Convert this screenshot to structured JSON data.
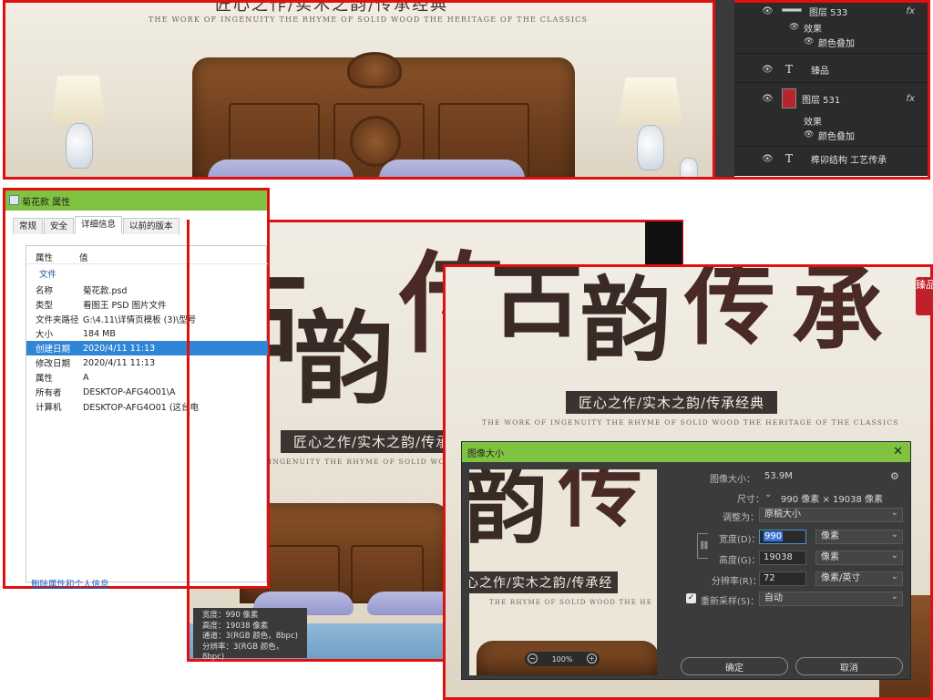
{
  "top_photo": {
    "title_line": "匠心之作/实木之韵/传承经典",
    "eng_line": "THE WORK OF INGENUITY   THE RHYME OF SOLID WOOD THE HERITAGE OF THE CLASSICS"
  },
  "layers_panel": {
    "rows": [
      {
        "label": "图层 533",
        "fx": "fx",
        "kind": "layer"
      },
      {
        "label": "效果",
        "kind": "effects"
      },
      {
        "label": "颜色叠加",
        "kind": "effect"
      },
      {
        "label": "臻品",
        "kind": "text",
        "icon": "T"
      },
      {
        "label": "图层 531",
        "fx": "fx",
        "kind": "layer"
      },
      {
        "label": "效果",
        "kind": "effects"
      },
      {
        "label": "颜色叠加",
        "kind": "effect"
      },
      {
        "label": "榫卯结构 工艺传承",
        "kind": "text",
        "icon": "T"
      }
    ]
  },
  "properties": {
    "title": "菊花款 属性",
    "tabs": [
      "常规",
      "安全",
      "详细信息",
      "以前的版本"
    ],
    "active_tab": "详细信息",
    "header_key": "属性",
    "header_val": "值",
    "section": "文件",
    "rows": [
      {
        "k": "名称",
        "v": "菊花款.psd"
      },
      {
        "k": "类型",
        "v": "看图王 PSD 图片文件"
      },
      {
        "k": "文件夹路径",
        "v": "G:\\4.11\\详情页模板 (3)\\型号"
      },
      {
        "k": "大小",
        "v": "184 MB"
      },
      {
        "k": "创建日期",
        "v": "2020/4/11 11:13"
      },
      {
        "k": "修改日期",
        "v": "2020/4/11 11:13"
      },
      {
        "k": "属性",
        "v": "A"
      },
      {
        "k": "所有者",
        "v": "DESKTOP-AFG4O01\\A"
      },
      {
        "k": "计算机",
        "v": "DESKTOP-AFG4O01 (这台电"
      }
    ],
    "remove_link": "删除属性和个人信息"
  },
  "mid_image": {
    "chars": [
      "古",
      "韵",
      "传"
    ],
    "sub": "匠心之作/实木之韵/传承",
    "eng": "THE WORK OF INGENUITY   THE RHYME OF SOLID WO",
    "info": [
      "宽度：990 像素",
      "高度：19038 像素",
      "通道：3(RGB 颜色，8bpc)",
      "分辨率：3(RGB 颜色，8bpc)"
    ]
  },
  "front_image": {
    "chars": [
      "古",
      "韵",
      "传",
      "承"
    ],
    "stamp": "臻品",
    "sub": "匠心之作/实木之韵/传承经典",
    "eng": "THE WORK OF INGENUITY   THE RHYME OF SOLID WOOD THE HERITAGE OF THE CLASSICS"
  },
  "image_size_dialog": {
    "title": "图像大小",
    "close": "✕",
    "image_size_label": "图像大小：",
    "image_size_value": "53.9M",
    "dimensions_label": "尺寸：",
    "dimensions_value": "990 像素 × 19038 像素",
    "fit_label": "调整为：",
    "fit_value": "原稿大小",
    "width_label": "宽度(D)：",
    "width_value": "990",
    "width_unit": "像素",
    "height_label": "高度(G)：",
    "height_value": "19038",
    "height_unit": "像素",
    "resolution_label": "分辨率(R)：",
    "resolution_value": "72",
    "resolution_unit": "像素/英寸",
    "resample_label": "重新采样(S)：",
    "resample_value": "自动",
    "resample_checked": true,
    "ok": "确定",
    "cancel": "取消",
    "preview_sub": "心之作/实木之韵/传承经",
    "preview_eng": "THE RHYME OF SOLID WOOD THE HE",
    "zoom": "100%"
  }
}
